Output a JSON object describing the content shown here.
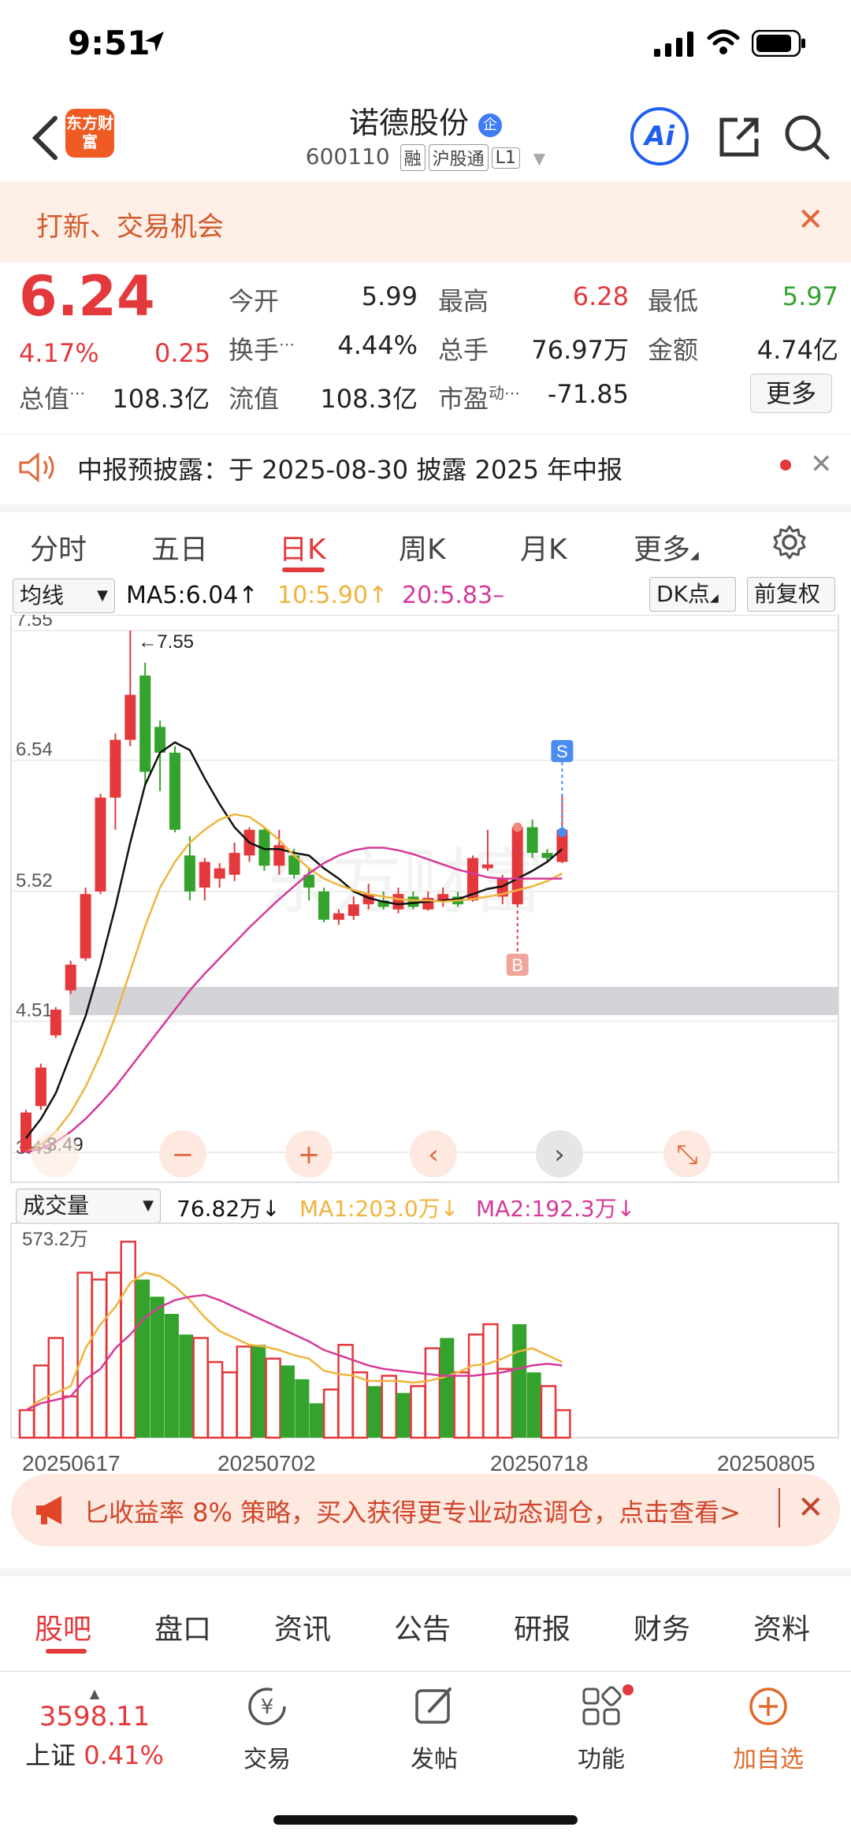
{
  "status": {
    "time": "9:51"
  },
  "header": {
    "logo_text": "东方财富",
    "stock_name": "诺德股份",
    "stock_badge": "企",
    "stock_code": "600110",
    "tags": [
      "融",
      "沪股通",
      "L1"
    ],
    "ai_label": "Ai"
  },
  "banner": {
    "text": "打新、交易机会"
  },
  "quote": {
    "price": "6.24",
    "change_pct": "4.17%",
    "change_abs": "0.25",
    "open_label": "今开",
    "open": "5.99",
    "high_label": "最高",
    "high": "6.28",
    "low_label": "最低",
    "low": "5.97",
    "turnover_label": "换手",
    "turnover": "4.44%",
    "volume_label": "总手",
    "volume": "76.97万",
    "amount_label": "金额",
    "amount": "4.74亿",
    "mktcap_label": "总值",
    "mktcap": "108.3亿",
    "float_label": "流值",
    "float": "108.3亿",
    "pe_label": "市盈",
    "pe_sup": "动",
    "pe": "-71.85",
    "more_label": "更多"
  },
  "notice": {
    "text": "中报预披露：于 2025-08-30 披露 2025 年中报"
  },
  "period_tabs": [
    "分时",
    "五日",
    "日K",
    "周K",
    "月K",
    "更多"
  ],
  "chart_header": {
    "indicator": "均线",
    "ma5": "MA5:6.04↑",
    "ma10": "10:5.90↑",
    "ma20": "20:5.83–",
    "dk_label": "DK点",
    "adjust_label": "前复权"
  },
  "volume_header": {
    "indicator": "成交量",
    "vol": "76.82万↓",
    "ma1": "MA1:203.0万↓",
    "ma2": "MA2:192.3万↓"
  },
  "colors": {
    "up": "#e3393c",
    "down": "#34a32d",
    "ma5": "#111111",
    "ma10": "#f0b43c",
    "ma20": "#d6399a"
  },
  "chart_data": [
    {
      "type": "candlestick",
      "yticks": [
        "7.55",
        "6.54",
        "5.52",
        "4.51",
        "3.49"
      ],
      "ylim": [
        3.49,
        7.55
      ],
      "max_label": "7.55",
      "min_label": "3.49",
      "signals": [
        "S",
        "B"
      ],
      "candles": [
        {
          "o": 3.49,
          "c": 3.8,
          "h": 3.82,
          "l": 3.49
        },
        {
          "o": 3.85,
          "c": 4.15,
          "h": 4.18,
          "l": 3.82
        },
        {
          "o": 4.4,
          "c": 4.6,
          "h": 4.62,
          "l": 4.38
        },
        {
          "o": 4.75,
          "c": 4.95,
          "h": 4.98,
          "l": 4.72
        },
        {
          "o": 5.0,
          "c": 5.5,
          "h": 5.55,
          "l": 4.98
        },
        {
          "o": 5.52,
          "c": 6.25,
          "h": 6.28,
          "l": 5.5
        },
        {
          "o": 6.25,
          "c": 6.7,
          "h": 6.75,
          "l": 6.0
        },
        {
          "o": 6.7,
          "c": 7.05,
          "h": 7.55,
          "l": 6.65
        },
        {
          "o": 7.2,
          "c": 6.45,
          "h": 7.3,
          "l": 6.35
        },
        {
          "o": 6.8,
          "c": 6.6,
          "h": 6.85,
          "l": 6.3
        },
        {
          "o": 6.6,
          "c": 6.0,
          "h": 6.65,
          "l": 5.98
        },
        {
          "o": 5.8,
          "c": 5.52,
          "h": 5.95,
          "l": 5.45
        },
        {
          "o": 5.55,
          "c": 5.75,
          "h": 5.78,
          "l": 5.45
        },
        {
          "o": 5.62,
          "c": 5.7,
          "h": 5.74,
          "l": 5.55
        },
        {
          "o": 5.65,
          "c": 5.82,
          "h": 5.9,
          "l": 5.6
        },
        {
          "o": 5.8,
          "c": 6.0,
          "h": 6.02,
          "l": 5.75
        },
        {
          "o": 6.0,
          "c": 5.72,
          "h": 6.02,
          "l": 5.68
        },
        {
          "o": 5.72,
          "c": 5.88,
          "h": 6.0,
          "l": 5.65
        },
        {
          "o": 5.8,
          "c": 5.65,
          "h": 5.85,
          "l": 5.62
        },
        {
          "o": 5.65,
          "c": 5.55,
          "h": 5.7,
          "l": 5.45
        },
        {
          "o": 5.52,
          "c": 5.3,
          "h": 5.55,
          "l": 5.28
        },
        {
          "o": 5.3,
          "c": 5.35,
          "h": 5.38,
          "l": 5.26
        },
        {
          "o": 5.33,
          "c": 5.42,
          "h": 5.48,
          "l": 5.3
        },
        {
          "o": 5.42,
          "c": 5.5,
          "h": 5.58,
          "l": 5.38
        },
        {
          "o": 5.45,
          "c": 5.4,
          "h": 5.52,
          "l": 5.38
        },
        {
          "o": 5.38,
          "c": 5.5,
          "h": 5.55,
          "l": 5.35
        },
        {
          "o": 5.48,
          "c": 5.4,
          "h": 5.52,
          "l": 5.38
        },
        {
          "o": 5.38,
          "c": 5.47,
          "h": 5.52,
          "l": 5.37
        },
        {
          "o": 5.45,
          "c": 5.5,
          "h": 5.55,
          "l": 5.4
        },
        {
          "o": 5.48,
          "c": 5.42,
          "h": 5.52,
          "l": 5.4
        },
        {
          "o": 5.45,
          "c": 5.78,
          "h": 5.8,
          "l": 5.44
        },
        {
          "o": 5.7,
          "c": 5.73,
          "h": 6.0,
          "l": 5.68
        },
        {
          "o": 5.48,
          "c": 5.62,
          "h": 5.65,
          "l": 5.42
        },
        {
          "o": 5.42,
          "c": 6.02,
          "h": 6.05,
          "l": 5.4
        },
        {
          "o": 6.02,
          "c": 5.82,
          "h": 6.08,
          "l": 5.78
        },
        {
          "o": 5.82,
          "c": 5.78,
          "h": 5.85,
          "l": 5.75
        },
        {
          "o": 5.75,
          "c": 6.0,
          "h": 6.28,
          "l": 5.74
        }
      ],
      "ma5": [
        3.6,
        3.75,
        3.95,
        4.25,
        4.55,
        4.95,
        5.4,
        5.9,
        6.35,
        6.6,
        6.68,
        6.62,
        6.4,
        6.2,
        6.02,
        5.9,
        5.85,
        5.85,
        5.82,
        5.8,
        5.7,
        5.62,
        5.52,
        5.47,
        5.44,
        5.42,
        5.43,
        5.44,
        5.45,
        5.46,
        5.5,
        5.54,
        5.56,
        5.62,
        5.68,
        5.75,
        5.85
      ],
      "ma10": [
        3.49,
        3.55,
        3.65,
        3.8,
        4.0,
        4.25,
        4.55,
        4.9,
        5.25,
        5.55,
        5.75,
        5.9,
        6.0,
        6.08,
        6.12,
        6.1,
        6.02,
        5.92,
        5.8,
        5.7,
        5.62,
        5.57,
        5.53,
        5.5,
        5.48,
        5.46,
        5.45,
        5.45,
        5.44,
        5.45,
        5.46,
        5.48,
        5.5,
        5.53,
        5.56,
        5.6,
        5.66
      ],
      "ma20": [
        3.49,
        3.52,
        3.57,
        3.65,
        3.75,
        3.87,
        4.0,
        4.15,
        4.3,
        4.45,
        4.6,
        4.75,
        4.88,
        5.0,
        5.12,
        5.24,
        5.35,
        5.46,
        5.56,
        5.66,
        5.74,
        5.8,
        5.84,
        5.86,
        5.86,
        5.84,
        5.81,
        5.77,
        5.73,
        5.69,
        5.66,
        5.63,
        5.62,
        5.62,
        5.62,
        5.62,
        5.62
      ]
    },
    {
      "type": "bar",
      "name": "成交量",
      "ymax_label": "573.2万",
      "x_labels": [
        "20250617",
        "20250702",
        "20250718",
        "20250805"
      ],
      "volumes": [
        80,
        210,
        290,
        120,
        480,
        460,
        480,
        570,
        460,
        410,
        360,
        300,
        290,
        220,
        190,
        265,
        270,
        230,
        210,
        170,
        100,
        140,
        270,
        190,
        150,
        180,
        130,
        150,
        260,
        290,
        190,
        300,
        330,
        200,
        330,
        190,
        150,
        80
      ],
      "ma1": [
        80,
        110,
        130,
        150,
        260,
        330,
        380,
        450,
        480,
        470,
        440,
        400,
        350,
        310,
        290,
        270,
        265,
        255,
        240,
        230,
        195,
        185,
        180,
        165,
        165,
        165,
        160,
        165,
        175,
        190,
        210,
        215,
        230,
        250,
        260,
        240,
        220
      ],
      "ma2": [
        80,
        100,
        110,
        120,
        170,
        200,
        260,
        300,
        350,
        380,
        400,
        410,
        415,
        400,
        380,
        360,
        340,
        320,
        300,
        280,
        255,
        240,
        225,
        210,
        200,
        195,
        190,
        185,
        180,
        180,
        180,
        185,
        190,
        200,
        210,
        215,
        210
      ]
    }
  ],
  "chart_controls": [
    "zoom-out",
    "zoom-in",
    "prev",
    "next",
    "expand"
  ],
  "ad": {
    "text": "匕收益率 8% 策略，买入获得更专业动态调仓，点击查看>"
  },
  "bottom_tabs": [
    "股吧",
    "盘口",
    "资讯",
    "公告",
    "研报",
    "财务",
    "资料"
  ],
  "navbar": {
    "index_value": "3598.11",
    "index_name": "上证",
    "index_change": "0.41%",
    "items": [
      "交易",
      "发帖",
      "功能",
      "加自选"
    ]
  }
}
